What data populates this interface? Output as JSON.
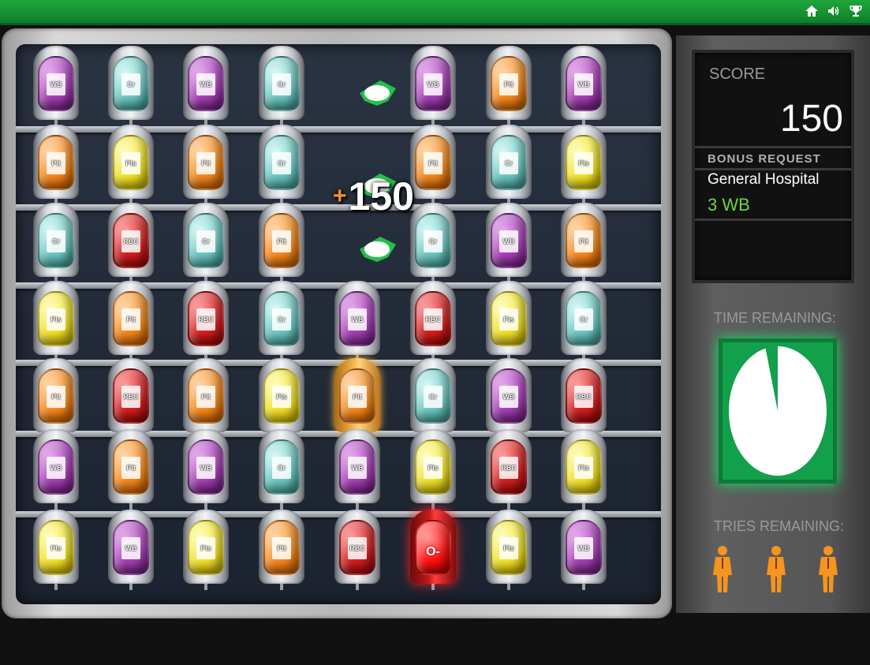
{
  "topbar": {
    "icons": [
      "home-icon",
      "sound-icon",
      "trophy-icon"
    ]
  },
  "board": {
    "rows": [
      [
        "WB",
        "Cr",
        "WB",
        "Cr",
        null,
        "WB",
        "Plt",
        "WB"
      ],
      [
        "Plt",
        "Pls",
        "Plt",
        "Cr",
        null,
        "Plt",
        "Cr",
        "Pls"
      ],
      [
        "Cr",
        "RBC",
        "Cr",
        "Plt",
        null,
        "Cr",
        "WB",
        "Plt"
      ],
      [
        "Pls",
        "Plt",
        "RBC",
        "Cr",
        "WB",
        "RBC",
        "Pls",
        "Cr"
      ],
      [
        "Plt",
        "RBC",
        "Plt",
        "Pls",
        "Plt",
        "Cr",
        "WB",
        "RBC"
      ],
      [
        "WB",
        "Plt",
        "WB",
        "Cr",
        "WB",
        "Pls",
        "RBC",
        "Pls"
      ],
      [
        "Pls",
        "WB",
        "Pls",
        "Plt",
        "RBC",
        "O-",
        "Pls",
        "WB"
      ]
    ],
    "selected": {
      "row": 4,
      "col": 4
    },
    "colors": {
      "WB": "purple",
      "Cr": "teal",
      "Plt": "orange",
      "Pls": "yellow",
      "RBC": "red",
      "O-": "onred"
    },
    "popup": {
      "plus": "+",
      "value": "150"
    }
  },
  "panel": {
    "score_label": "SCORE",
    "score_value": "150",
    "bonus_label": "BONUS REQUEST",
    "bonus_name": "General Hospital",
    "bonus_qty": "3 WB",
    "time_label": "TIME REMAINING:",
    "time_remaining_fraction": 0.96,
    "tries_label": "TRIES REMAINING:",
    "tries_remaining": 3
  },
  "colors": {
    "accent_green": "#12a04a",
    "bonus_green": "#6bd93c",
    "tries_orange": "#f5941f"
  }
}
